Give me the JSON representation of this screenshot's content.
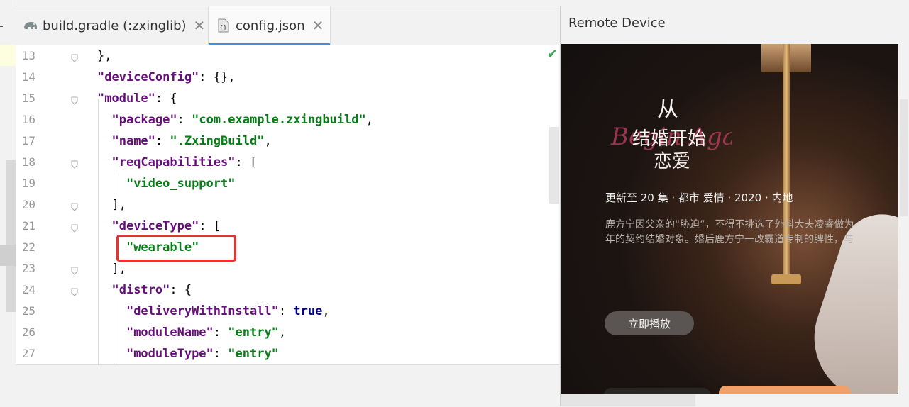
{
  "tabs": [
    {
      "label": "build.gradle (:zxinglib)",
      "icon": "gradle-elephant-icon",
      "active": false
    },
    {
      "label": "config.json",
      "icon": "json-file-icon",
      "active": true
    }
  ],
  "editor": {
    "line_numbers": [
      "13",
      "14",
      "15",
      "16",
      "17",
      "18",
      "19",
      "20",
      "21",
      "22",
      "23",
      "24",
      "25",
      "26",
      "27"
    ],
    "lines": [
      {
        "indent": "",
        "tokens": [
          {
            "t": "pun",
            "v": "},"
          }
        ]
      },
      {
        "indent": "",
        "tokens": [
          {
            "t": "key",
            "v": "\"deviceConfig\""
          },
          {
            "t": "pun",
            "v": ": {},"
          }
        ]
      },
      {
        "indent": "",
        "tokens": [
          {
            "t": "key",
            "v": "\"module\""
          },
          {
            "t": "pun",
            "v": ": {"
          }
        ]
      },
      {
        "indent": "  ",
        "tokens": [
          {
            "t": "key",
            "v": "\"package\""
          },
          {
            "t": "pun",
            "v": ": "
          },
          {
            "t": "str",
            "v": "\"com.example.zxingbuild\""
          },
          {
            "t": "pun",
            "v": ","
          }
        ]
      },
      {
        "indent": "  ",
        "tokens": [
          {
            "t": "key",
            "v": "\"name\""
          },
          {
            "t": "pun",
            "v": ": "
          },
          {
            "t": "str",
            "v": "\".ZxingBuild\""
          },
          {
            "t": "pun",
            "v": ","
          }
        ]
      },
      {
        "indent": "  ",
        "tokens": [
          {
            "t": "key",
            "v": "\"reqCapabilities\""
          },
          {
            "t": "pun",
            "v": ": ["
          }
        ]
      },
      {
        "indent": "    ",
        "tokens": [
          {
            "t": "str",
            "v": "\"video_support\""
          }
        ]
      },
      {
        "indent": "  ",
        "tokens": [
          {
            "t": "pun",
            "v": "],"
          }
        ]
      },
      {
        "indent": "  ",
        "tokens": [
          {
            "t": "key",
            "v": "\"deviceType\""
          },
          {
            "t": "pun",
            "v": ": ["
          }
        ]
      },
      {
        "indent": "    ",
        "tokens": [
          {
            "t": "str",
            "v": "\"wearable\""
          }
        ]
      },
      {
        "indent": "  ",
        "tokens": [
          {
            "t": "pun",
            "v": "],"
          }
        ]
      },
      {
        "indent": "  ",
        "tokens": [
          {
            "t": "key",
            "v": "\"distro\""
          },
          {
            "t": "pun",
            "v": ": {"
          }
        ]
      },
      {
        "indent": "    ",
        "tokens": [
          {
            "t": "key",
            "v": "\"deliveryWithInstall\""
          },
          {
            "t": "pun",
            "v": ": "
          },
          {
            "t": "kw",
            "v": "true"
          },
          {
            "t": "pun",
            "v": ","
          }
        ]
      },
      {
        "indent": "    ",
        "tokens": [
          {
            "t": "key",
            "v": "\"moduleName\""
          },
          {
            "t": "pun",
            "v": ": "
          },
          {
            "t": "str",
            "v": "\"entry\""
          },
          {
            "t": "pun",
            "v": ","
          }
        ]
      },
      {
        "indent": "    ",
        "tokens": [
          {
            "t": "key",
            "v": "\"moduleType\""
          },
          {
            "t": "pun",
            "v": ": "
          },
          {
            "t": "str",
            "v": "\"entry\""
          }
        ]
      }
    ],
    "highlighted_line": "22",
    "status_icon": "check-icon"
  },
  "remote_device": {
    "title": "Remote Device",
    "show": {
      "logo_text": "从结婚开始恋爱",
      "logo_script": "Begin Again",
      "meta": "更新至 20 集 · 都市 爱情 · 2020 · 内地",
      "desc_line1": "鹿方宁因父亲的“胁迫”，不得不挑选了外科大夫凌睿做为",
      "desc_line2": "年的契约结婚对象。婚后鹿方宁一改霸道专制的脾性，与",
      "play_label": "立即播放"
    }
  },
  "colors": {
    "accent_tab": "#3e8fe6",
    "highlight_box": "#e8342a",
    "json_key": "#660e7a",
    "json_string": "#067d17",
    "json_keyword": "#000080"
  }
}
